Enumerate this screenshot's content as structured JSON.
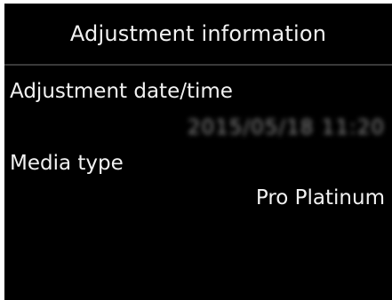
{
  "header": {
    "title": "Adjustment information"
  },
  "fields": {
    "adjustment_datetime": {
      "label": "Adjustment date/time",
      "value": "2015/05/18 11:20"
    },
    "media_type": {
      "label": "Media type",
      "value": "Pro Platinum"
    }
  },
  "colors": {
    "screen_background": "#000000",
    "text": "#f2f2f2",
    "divider": "#3a3a3a"
  }
}
